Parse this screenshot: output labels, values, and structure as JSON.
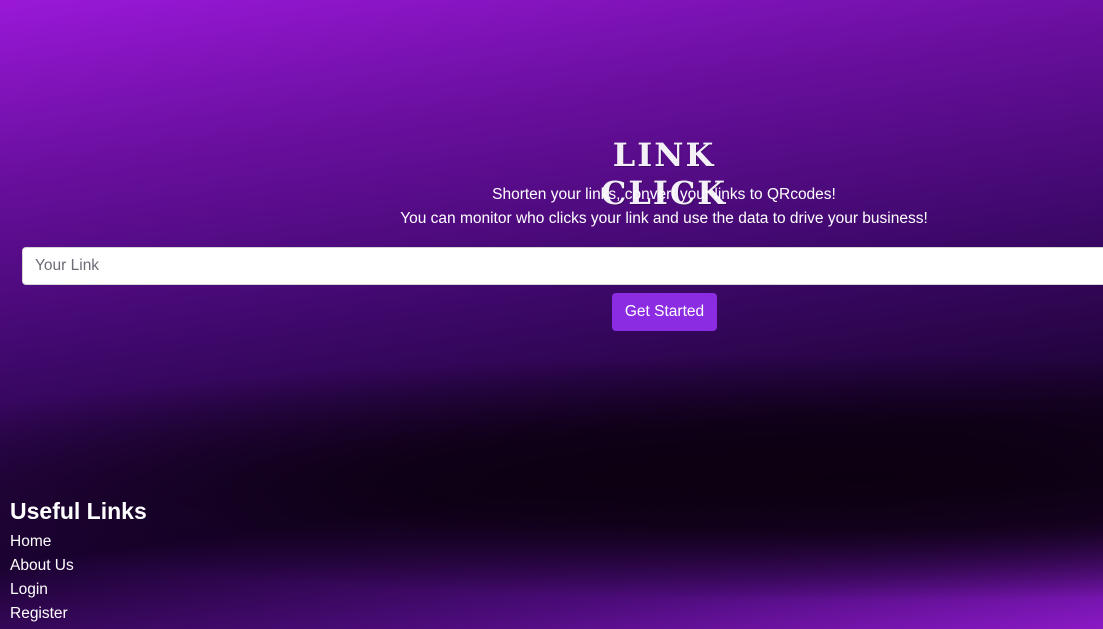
{
  "hero": {
    "logo_text": "LINK CLICK",
    "tagline_line1": "Shorten your links, convert your links to QRcodes!",
    "tagline_line2": "You can monitor who clicks your link and use the data to drive your business!",
    "link_input": {
      "value": "",
      "placeholder": "Your Link"
    },
    "cta_label": "Get Started"
  },
  "footer": {
    "title": "Useful Links",
    "links": [
      {
        "label": "Home"
      },
      {
        "label": "About Us"
      },
      {
        "label": "Login"
      },
      {
        "label": "Register"
      }
    ]
  },
  "colors": {
    "accent": "#8b2be2",
    "background_top": "#9a18d8",
    "background_dark": "#0b0010",
    "text": "#ffffff"
  }
}
